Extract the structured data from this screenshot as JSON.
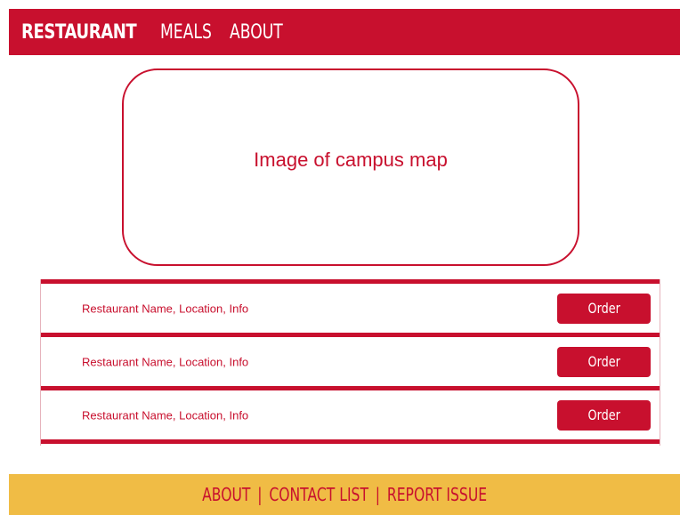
{
  "header": {
    "brand": "RESTAURANT",
    "nav": [
      {
        "label": "MEALS"
      },
      {
        "label": "ABOUT"
      }
    ]
  },
  "map": {
    "placeholder": "Image of campus map"
  },
  "restaurants": [
    {
      "info": "Restaurant Name, Location, Info",
      "button": "Order"
    },
    {
      "info": "Restaurant Name, Location, Info",
      "button": "Order"
    },
    {
      "info": "Restaurant Name, Location, Info",
      "button": "Order"
    }
  ],
  "footer": {
    "links": [
      "ABOUT",
      "CONTACT LIST",
      "REPORT ISSUE"
    ],
    "separator": "|"
  },
  "colors": {
    "primary_red": "#c8102e",
    "footer_gold": "#f0bc45",
    "background": "#ffffff"
  }
}
